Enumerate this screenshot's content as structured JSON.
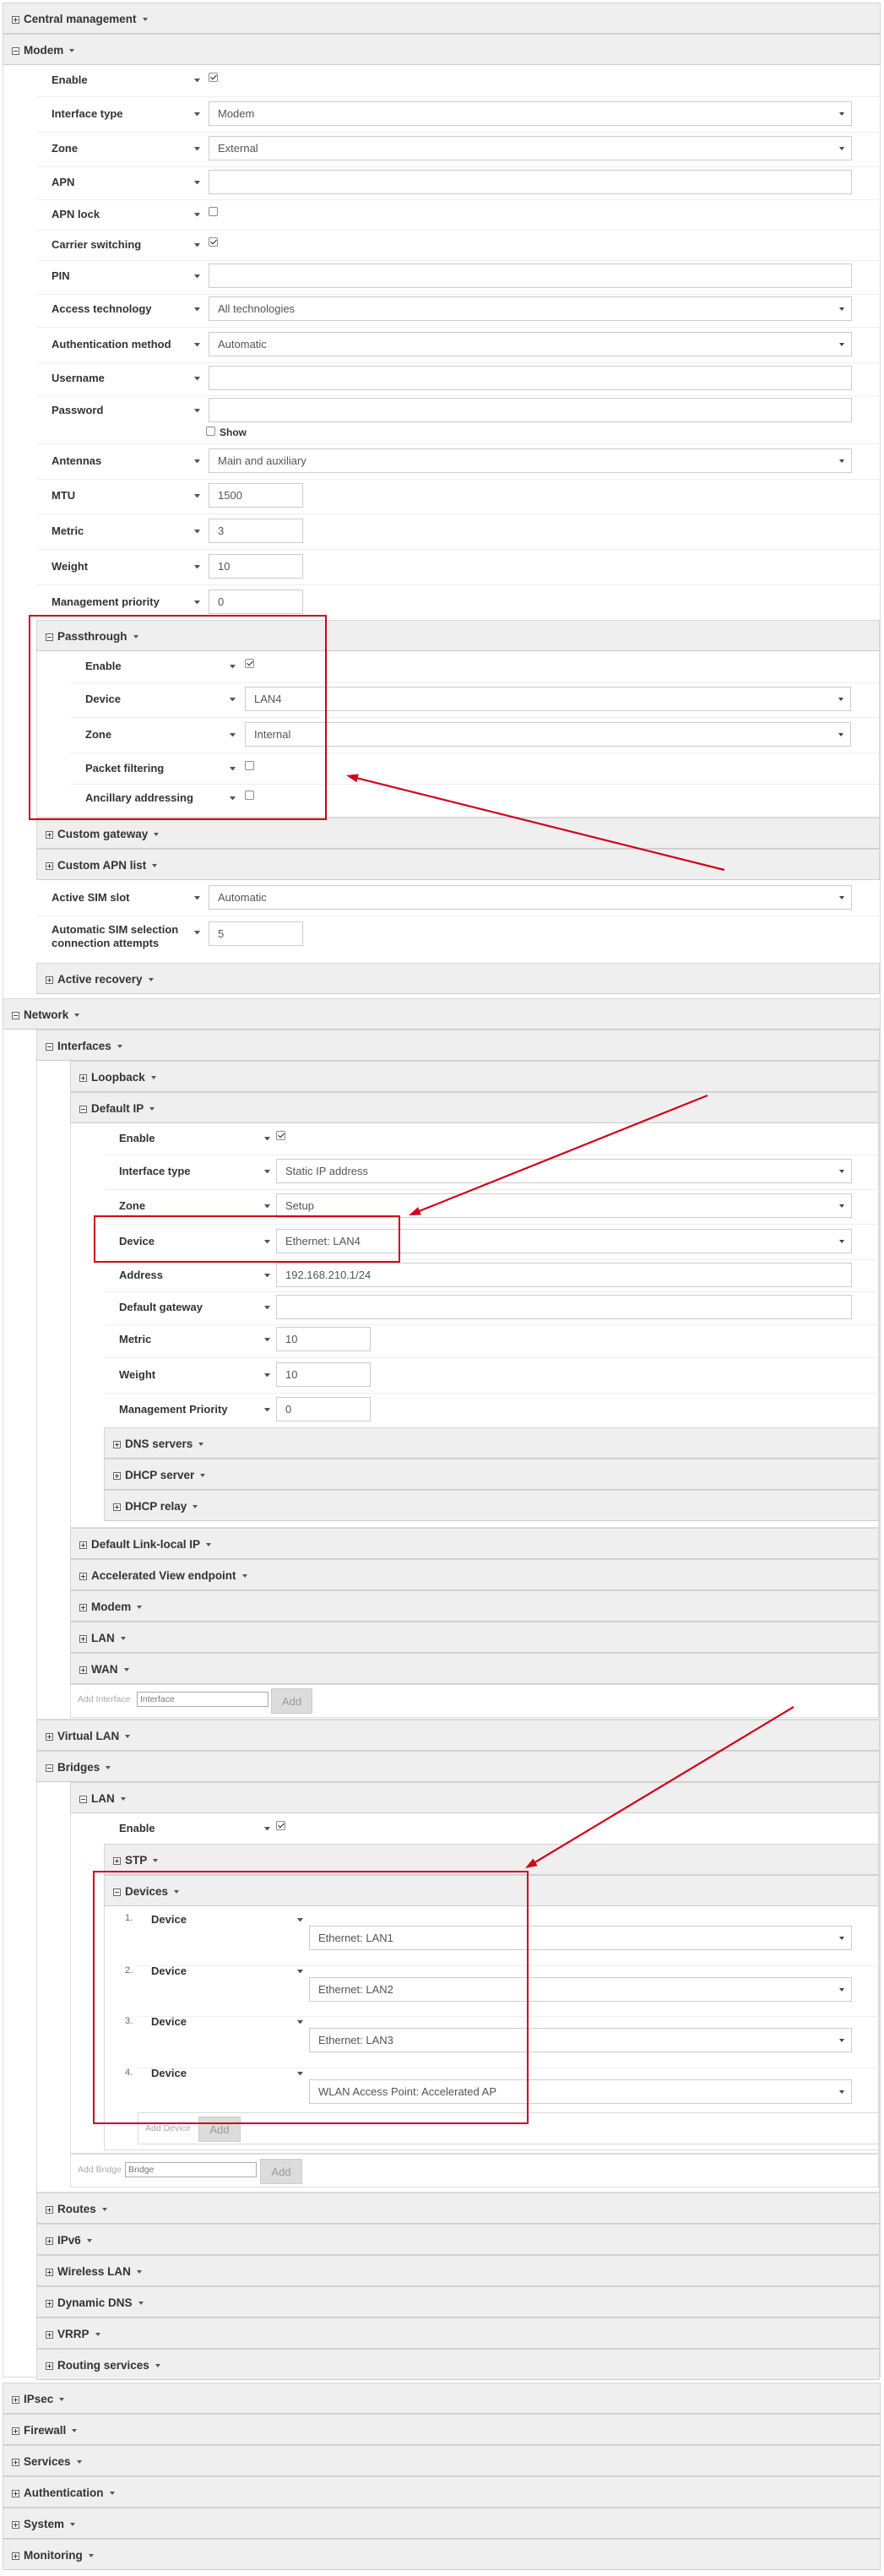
{
  "sections": {
    "central_management": "Central management",
    "modem": "Modem",
    "passthrough": "Passthrough",
    "custom_gateway": "Custom gateway",
    "custom_apn_list": "Custom APN list",
    "active_recovery": "Active recovery",
    "network": "Network",
    "interfaces": "Interfaces",
    "loopback": "Loopback",
    "default_ip": "Default IP",
    "dns_servers": "DNS servers",
    "dhcp_server": "DHCP server",
    "dhcp_relay": "DHCP relay",
    "default_link_local_ip": "Default Link-local IP",
    "accelerated_view_endpoint": "Accelerated View endpoint",
    "iface_modem": "Modem",
    "iface_lan": "LAN",
    "iface_wan": "WAN",
    "virtual_lan": "Virtual LAN",
    "bridges": "Bridges",
    "bridge_lan": "LAN",
    "stp": "STP",
    "devices": "Devices",
    "routes": "Routes",
    "ipv6": "IPv6",
    "wireless_lan": "Wireless LAN",
    "dynamic_dns": "Dynamic DNS",
    "vrrp": "VRRP",
    "routing_services": "Routing services",
    "ipsec": "IPsec",
    "firewall": "Firewall",
    "services": "Services",
    "authentication": "Authentication",
    "system": "System",
    "monitoring": "Monitoring"
  },
  "modem": {
    "enable_label": "Enable",
    "interface_type_label": "Interface type",
    "interface_type_value": "Modem",
    "zone_label": "Zone",
    "zone_value": "External",
    "apn_label": "APN",
    "apn_value": "",
    "apn_lock_label": "APN lock",
    "carrier_switching_label": "Carrier switching",
    "pin_label": "PIN",
    "pin_value": "",
    "access_technology_label": "Access technology",
    "access_technology_value": "All technologies",
    "auth_method_label": "Authentication method",
    "auth_method_value": "Automatic",
    "username_label": "Username",
    "username_value": "",
    "password_label": "Password",
    "password_value": "",
    "show_label": "Show",
    "antennas_label": "Antennas",
    "antennas_value": "Main and auxiliary",
    "mtu_label": "MTU",
    "mtu_value": "1500",
    "metric_label": "Metric",
    "metric_value": "3",
    "weight_label": "Weight",
    "weight_value": "10",
    "mgmt_priority_label": "Management priority",
    "mgmt_priority_value": "0",
    "active_sim_label": "Active SIM slot",
    "active_sim_value": "Automatic",
    "auto_sim_label_1": "Automatic SIM selection",
    "auto_sim_label_2": "connection attempts",
    "auto_sim_value": "5"
  },
  "passthrough": {
    "enable_label": "Enable",
    "device_label": "Device",
    "device_value": "LAN4",
    "zone_label": "Zone",
    "zone_value": "Internal",
    "packet_filtering_label": "Packet filtering",
    "ancillary_label": "Ancillary addressing"
  },
  "default_ip": {
    "enable_label": "Enable",
    "interface_type_label": "Interface type",
    "interface_type_value": "Static IP address",
    "zone_label": "Zone",
    "zone_value": "Setup",
    "device_label": "Device",
    "device_value": "Ethernet: LAN4",
    "address_label": "Address",
    "address_value": "192.168.210.1/24",
    "gateway_label": "Default gateway",
    "gateway_value": "",
    "metric_label": "Metric",
    "metric_value": "10",
    "weight_label": "Weight",
    "weight_value": "10",
    "mgmt_priority_label": "Management Priority",
    "mgmt_priority_value": "0"
  },
  "add_interface": {
    "label": "Add Interface",
    "value": "Interface",
    "button": "Add"
  },
  "bridge_lan": {
    "enable_label": "Enable",
    "device_label": "Device",
    "devices": [
      {
        "num": "1.",
        "value": "Ethernet: LAN1"
      },
      {
        "num": "2.",
        "value": "Ethernet: LAN2"
      },
      {
        "num": "3.",
        "value": "Ethernet: LAN3"
      },
      {
        "num": "4.",
        "value": "WLAN Access Point: Accelerated AP"
      }
    ]
  },
  "add_device": {
    "label": "Add Device",
    "button": "Add"
  },
  "add_bridge": {
    "label": "Add Bridge",
    "value": "Bridge",
    "button": "Add"
  },
  "colors": {
    "annotation": "#d0021b",
    "header_bg": "#efefef",
    "border": "#d6d6d6"
  }
}
